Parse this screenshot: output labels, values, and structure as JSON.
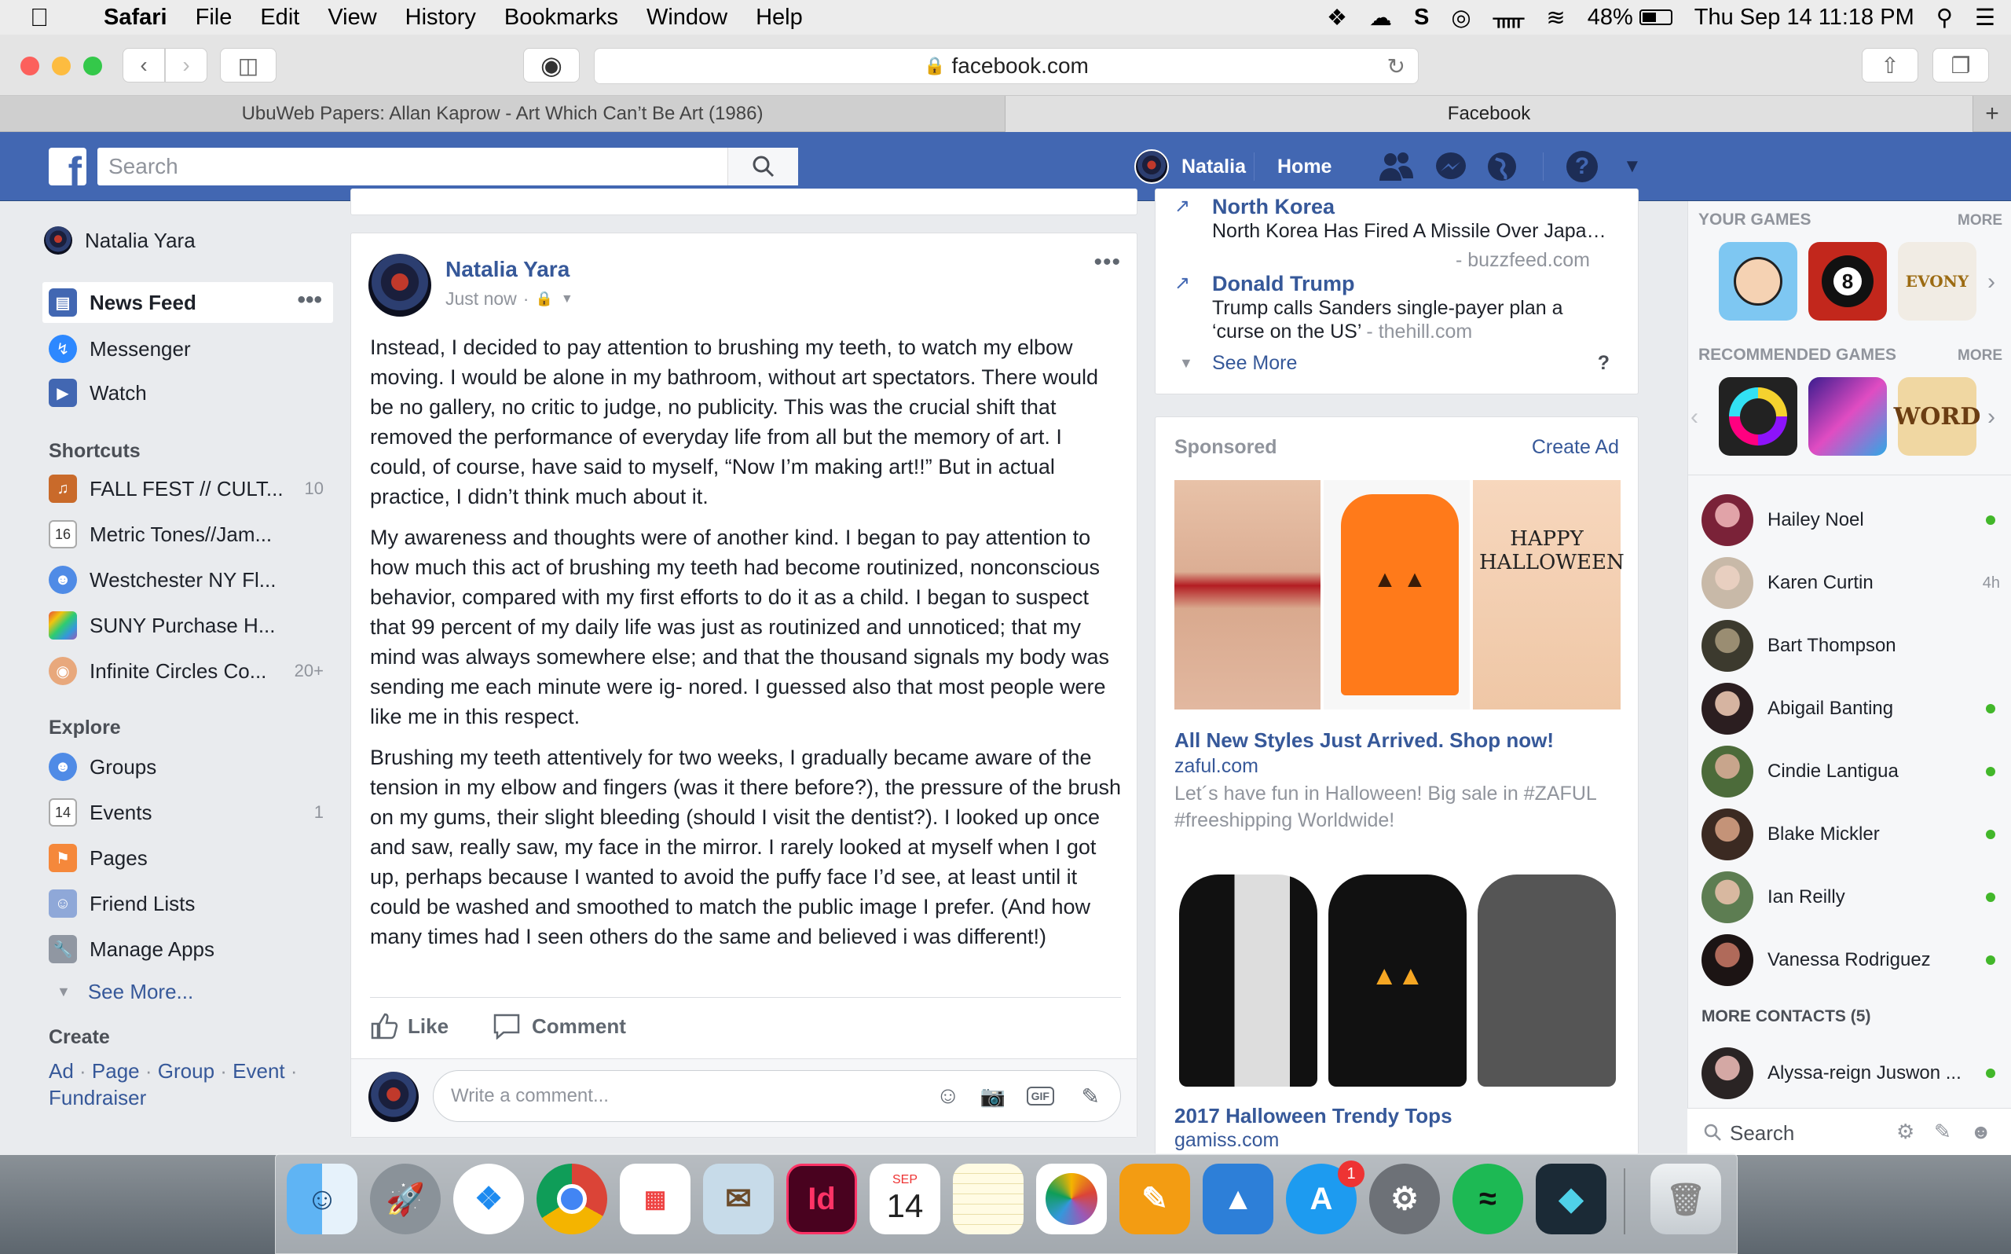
{
  "menubar": {
    "app": "Safari",
    "items": [
      "File",
      "Edit",
      "View",
      "History",
      "Bookmarks",
      "Window",
      "Help"
    ],
    "battery": "48%",
    "datetime": "Thu Sep 14  11:18 PM"
  },
  "browser": {
    "url": "facebook.com",
    "tabs": [
      "UbuWeb Papers: Allan Kaprow - Art Which Can’t Be Art (1986)",
      "Facebook"
    ]
  },
  "fb_header": {
    "search_placeholder": "Search",
    "user": "Natalia",
    "home": "Home"
  },
  "left_nav": {
    "profile": "Natalia Yara",
    "main": [
      {
        "label": "News Feed",
        "icon": "news-feed-icon"
      },
      {
        "label": "Messenger",
        "icon": "messenger-icon"
      },
      {
        "label": "Watch",
        "icon": "watch-icon"
      }
    ],
    "shortcuts_title": "Shortcuts",
    "shortcuts": [
      {
        "label": "FALL FEST // CULT...",
        "count": "10"
      },
      {
        "label": "Metric Tones//Jam...",
        "count": ""
      },
      {
        "label": "Westchester NY Fl...",
        "count": ""
      },
      {
        "label": "SUNY Purchase H...",
        "count": ""
      },
      {
        "label": "Infinite Circles Co...",
        "count": "20+"
      }
    ],
    "explore_title": "Explore",
    "explore": [
      {
        "label": "Groups",
        "count": ""
      },
      {
        "label": "Events",
        "count": "1"
      },
      {
        "label": "Pages",
        "count": ""
      },
      {
        "label": "Friend Lists",
        "count": ""
      },
      {
        "label": "Manage Apps",
        "count": ""
      }
    ],
    "see_more": "See More...",
    "create_title": "Create",
    "create_links": [
      "Ad",
      "Page",
      "Group",
      "Event"
    ],
    "create_last": "Fundraiser"
  },
  "post": {
    "author": "Natalia Yara",
    "time": "Just now",
    "paragraphs": [
      "Instead, I decided to pay attention to brushing my teeth, to watch my elbow moving. I would be alone in my bathroom, without art spectators. There would be no gallery, no critic to judge, no publicity. This was the crucial shift that removed the performance of everyday life from all but the memory of art. I could, of course, have said to myself, “Now I’m making art!!” But in actual practice, I didn’t think much about it.",
      "My awareness and thoughts were of another kind. I began to pay attention to how much this act of brushing my teeth had become routinized, nonconscious behavior, compared with my first efforts to do it as a child. I began to suspect that 99 percent of my daily life was just as routinized and unnoticed; that my mind was always somewhere else; and that the thousand signals my body was sending me each minute were ig- nored. I guessed also that most people were like me in this respect.",
      "Brushing my teeth attentively for two weeks, I gradually became aware of the tension in my elbow and fingers (was it there before?), the pressure of the brush on my gums, their slight bleeding (should I visit the dentist?). I looked up once and saw, really saw, my face in the mirror. I rarely looked at myself when I got up, perhaps because I wanted to avoid the puffy face I’d see, at least until it could be washed and smoothed to match the public image I prefer. (And how many times had I seen others do the same and believed i was different!)"
    ],
    "like": "Like",
    "comment": "Comment",
    "comment_placeholder": "Write a comment..."
  },
  "trending": {
    "items": [
      {
        "title": "North Korea",
        "text": "North Korea Has Fired A Missile Over Japan Into The Pacific…",
        "source": "buzzfeed.com"
      },
      {
        "title": "Donald Trump",
        "text": "Trump calls Sanders single-payer plan a ‘curse on the US’",
        "source": "thehill.com"
      }
    ],
    "see_more": "See More",
    "help": "?"
  },
  "sponsored": {
    "title": "Sponsored",
    "create_ad": "Create Ad",
    "ads": [
      {
        "headline": "All New Styles Just Arrived. Shop now!",
        "domain": "zaful.com",
        "desc": "Let´s have fun in Halloween! Big sale in #ZAFUL #freeshipping Worldwide!",
        "image_text": "HAPPY HALLOWEEN"
      },
      {
        "headline": "2017 Halloween Trendy Tops",
        "domain": "gamiss.com"
      }
    ]
  },
  "games": {
    "your_games": "YOUR GAMES",
    "recommended": "RECOMMENDED GAMES",
    "more": "MORE",
    "tile_text": [
      "8",
      "EVONY",
      "WORD"
    ]
  },
  "chat": {
    "contacts": [
      {
        "name": "Hailey Noel",
        "status": "online"
      },
      {
        "name": "Karen Curtin",
        "status": "4h"
      },
      {
        "name": "Bart Thompson",
        "status": ""
      },
      {
        "name": "Abigail Banting",
        "status": "online"
      },
      {
        "name": "Cindie Lantigua",
        "status": "online"
      },
      {
        "name": "Blake Mickler",
        "status": "online"
      },
      {
        "name": "Ian Reilly",
        "status": "online"
      },
      {
        "name": "Vanessa Rodriguez",
        "status": "online"
      }
    ],
    "more_contacts": "MORE CONTACTS (5)",
    "more_list": [
      {
        "name": "Alyssa-reign Juswon ...",
        "status": "online"
      }
    ],
    "search_placeholder": "Search"
  },
  "dock": {
    "calendar_month": "SEP",
    "calendar_day": "14",
    "appstore_badge": "1",
    "indesign": "Id"
  },
  "colors": {
    "fb_blue": "#4267b2",
    "link": "#365899",
    "online": "#42b72a"
  }
}
